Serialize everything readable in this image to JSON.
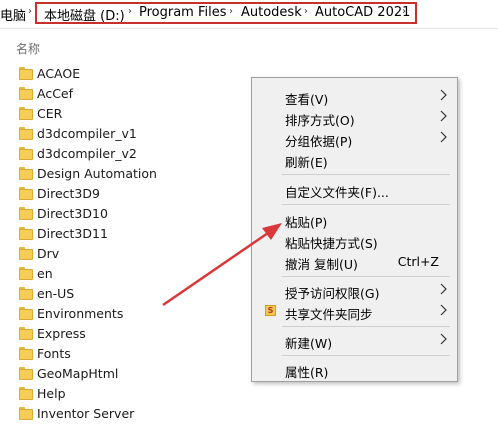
{
  "address_bar": {
    "root": "电脑",
    "crumbs": [
      "本地磁盘 (D:)",
      "Program Files",
      "Autodesk",
      "AutoCAD 2021"
    ]
  },
  "column_header": "名称",
  "files": [
    "ACAOE",
    "AcCef",
    "CER",
    "d3dcompiler_v1",
    "d3dcompiler_v2",
    "Design Automation",
    "Direct3D9",
    "Direct3D10",
    "Direct3D11",
    "Drv",
    "en",
    "en-US",
    "Environments",
    "Express",
    "Fonts",
    "GeoMapHtml",
    "Help",
    "Inventor Server"
  ],
  "context_menu": {
    "view": "查看(V)",
    "sort": "排序方式(O)",
    "group": "分组依据(P)",
    "refresh": "刷新(E)",
    "customize": "自定义文件夹(F)...",
    "paste": "粘贴(P)",
    "paste_shortcut": "粘贴快捷方式(S)",
    "undo_copy": "撤消 复制(U)",
    "undo_shortcut": "Ctrl+Z",
    "grant_access": "授予访问权限(G)",
    "shared_sync": "共享文件夹同步",
    "new": "新建(W)",
    "properties": "属性(R)"
  },
  "colors": {
    "highlight_box": "#c9302c",
    "arrow": "#d9383a",
    "menu_bg": "#f0f0f0",
    "folder": "#f5cd57"
  }
}
